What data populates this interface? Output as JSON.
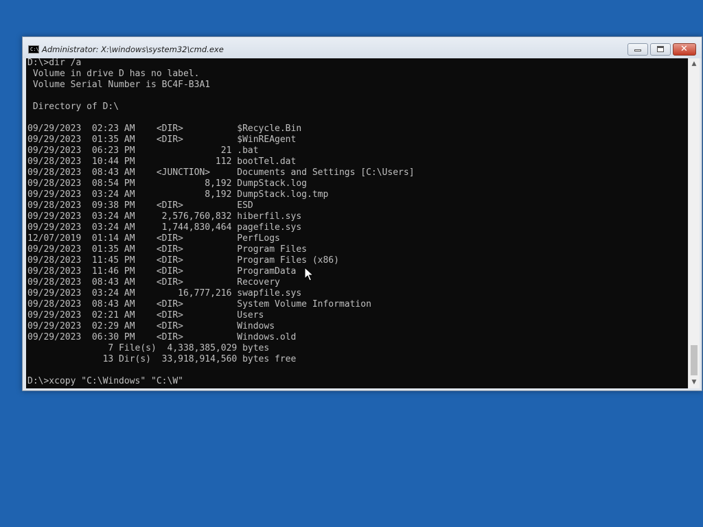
{
  "window": {
    "title": "Administrator: X:\\windows\\system32\\cmd.exe",
    "icon_glyph": "C:\\"
  },
  "console": {
    "lines": [
      "D:\\>dir /a",
      " Volume in drive D has no label.",
      " Volume Serial Number is BC4F-B3A1",
      "",
      " Directory of D:\\",
      "",
      "09/29/2023  02:23 AM    <DIR>          $Recycle.Bin",
      "09/29/2023  01:35 AM    <DIR>          $WinREAgent",
      "09/29/2023  06:23 PM                21 .bat",
      "09/28/2023  10:44 PM               112 bootTel.dat",
      "09/28/2023  08:43 AM    <JUNCTION>     Documents and Settings [C:\\Users]",
      "09/28/2023  08:54 PM             8,192 DumpStack.log",
      "09/29/2023  03:24 AM             8,192 DumpStack.log.tmp",
      "09/28/2023  09:38 PM    <DIR>          ESD",
      "09/29/2023  03:24 AM     2,576,760,832 hiberfil.sys",
      "09/29/2023  03:24 AM     1,744,830,464 pagefile.sys",
      "12/07/2019  01:14 AM    <DIR>          PerfLogs",
      "09/29/2023  01:35 AM    <DIR>          Program Files",
      "09/28/2023  11:45 PM    <DIR>          Program Files (x86)",
      "09/28/2023  11:46 PM    <DIR>          ProgramData",
      "09/28/2023  08:43 AM    <DIR>          Recovery",
      "09/29/2023  03:24 AM        16,777,216 swapfile.sys",
      "09/28/2023  08:43 AM    <DIR>          System Volume Information",
      "09/29/2023  02:21 AM    <DIR>          Users",
      "09/29/2023  02:29 AM    <DIR>          Windows",
      "09/29/2023  06:30 PM    <DIR>          Windows.old",
      "               7 File(s)  4,338,385,029 bytes",
      "              13 Dir(s)  33,918,914,560 bytes free",
      "",
      "D:\\>xcopy \"C:\\Windows\" \"C:\\W\""
    ]
  },
  "colors": {
    "desktop": "#1f63b0",
    "console_bg": "#0c0c0c",
    "console_text": "#c0c0c0"
  },
  "icons": {
    "app": "cmd-icon",
    "minimize": "minimize-icon",
    "maximize": "maximize-icon",
    "close": "close-icon",
    "cursor": "mouse-pointer-icon"
  }
}
